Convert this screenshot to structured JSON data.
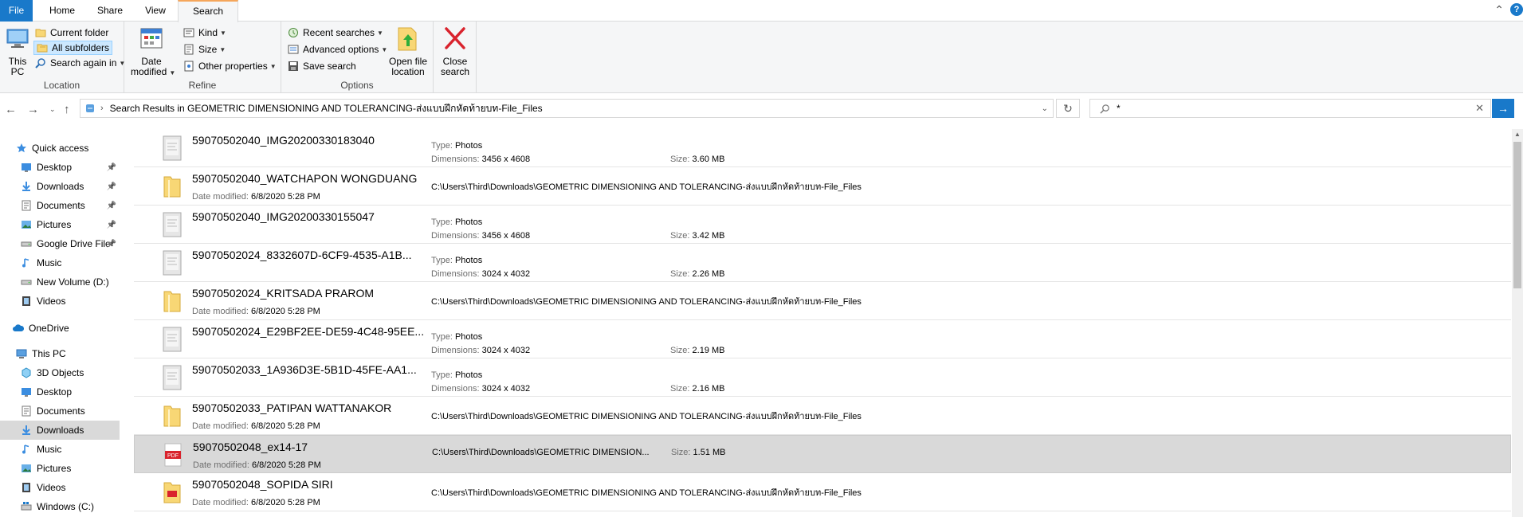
{
  "tabs": {
    "file": "File",
    "home": "Home",
    "share": "Share",
    "view": "View",
    "search": "Search"
  },
  "ribbon": {
    "location": {
      "this_pc": "This PC",
      "current_folder": "Current folder",
      "all_subfolders": "All subfolders",
      "search_again_in": "Search again in",
      "label": "Location"
    },
    "refine": {
      "date_modified_1": "Date",
      "date_modified_2": "modified",
      "kind": "Kind",
      "size": "Size",
      "other_properties": "Other properties",
      "label": "Refine"
    },
    "options": {
      "recent_searches": "Recent searches",
      "advanced_options": "Advanced options",
      "save_search": "Save search",
      "open_file_location_1": "Open file",
      "open_file_location_2": "location",
      "label": "Options"
    },
    "close": {
      "line1": "Close",
      "line2": "search"
    }
  },
  "address": {
    "path": "Search Results in GEOMETRIC DIMENSIONING AND TOLERANCING-ส่งแบบฝึกหัดท้ายบท-File_Files",
    "search_value": "*"
  },
  "sidebar": {
    "items": [
      {
        "label": "Quick access",
        "icon": "star-icon",
        "pinned": false
      },
      {
        "label": "Desktop",
        "icon": "desktop-icon",
        "pinned": true
      },
      {
        "label": "Downloads",
        "icon": "download-icon",
        "pinned": true
      },
      {
        "label": "Documents",
        "icon": "documents-icon",
        "pinned": true
      },
      {
        "label": "Pictures",
        "icon": "pictures-icon",
        "pinned": true
      },
      {
        "label": "Google Drive File",
        "icon": "drive-icon",
        "pinned": true
      },
      {
        "label": "Music",
        "icon": "music-icon",
        "pinned": false
      },
      {
        "label": "New Volume (D:)",
        "icon": "drive-icon",
        "pinned": false
      },
      {
        "label": "Videos",
        "icon": "videos-icon",
        "pinned": false
      },
      {
        "label": "OneDrive",
        "icon": "cloud-icon",
        "pinned": false
      },
      {
        "label": "This PC",
        "icon": "computer-icon",
        "pinned": false
      },
      {
        "label": "3D Objects",
        "icon": "cube-icon",
        "pinned": false
      },
      {
        "label": "Desktop",
        "icon": "desktop-icon",
        "pinned": false
      },
      {
        "label": "Documents",
        "icon": "documents-icon",
        "pinned": false
      },
      {
        "label": "Downloads",
        "icon": "download-icon",
        "pinned": false,
        "selected": true
      },
      {
        "label": "Music",
        "icon": "music-icon",
        "pinned": false
      },
      {
        "label": "Pictures",
        "icon": "pictures-icon",
        "pinned": false
      },
      {
        "label": "Videos",
        "icon": "videos-icon",
        "pinned": false
      },
      {
        "label": "Windows (C:)",
        "icon": "windows-drive-icon",
        "pinned": false
      }
    ]
  },
  "labels": {
    "type": "Type:",
    "dimensions": "Dimensions:",
    "size": "Size:",
    "date_modified": "Date modified:"
  },
  "results": [
    {
      "name": "59070502040_IMG20200330183040",
      "kind": "photo",
      "type": "Photos",
      "dimensions": "3456 x 4608",
      "size": "3.60 MB"
    },
    {
      "name": "59070502040_WATCHAPON WONGDUANG",
      "kind": "folder",
      "date": "6/8/2020 5:28 PM",
      "path": "C:\\Users\\Third\\Downloads\\GEOMETRIC DIMENSIONING AND TOLERANCING-ส่งแบบฝึกหัดท้ายบท-File_Files"
    },
    {
      "name": "59070502040_IMG20200330155047",
      "kind": "photo",
      "type": "Photos",
      "dimensions": "3456 x 4608",
      "size": "3.42 MB"
    },
    {
      "name": "59070502024_8332607D-6CF9-4535-A1B...",
      "kind": "photo",
      "type": "Photos",
      "dimensions": "3024 x 4032",
      "size": "2.26 MB"
    },
    {
      "name": "59070502024_KRITSADA PRAROM",
      "kind": "folder",
      "date": "6/8/2020 5:28 PM",
      "path": "C:\\Users\\Third\\Downloads\\GEOMETRIC DIMENSIONING AND TOLERANCING-ส่งแบบฝึกหัดท้ายบท-File_Files"
    },
    {
      "name": "59070502024_E29BF2EE-DE59-4C48-95EE...",
      "kind": "photo",
      "type": "Photos",
      "dimensions": "3024 x 4032",
      "size": "2.19 MB"
    },
    {
      "name": "59070502033_1A936D3E-5B1D-45FE-AA1...",
      "kind": "photo",
      "type": "Photos",
      "dimensions": "3024 x 4032",
      "size": "2.16 MB"
    },
    {
      "name": "59070502033_PATIPAN WATTANAKOR",
      "kind": "folder",
      "date": "6/8/2020 5:28 PM",
      "path": "C:\\Users\\Third\\Downloads\\GEOMETRIC DIMENSIONING AND TOLERANCING-ส่งแบบฝึกหัดท้ายบท-File_Files"
    },
    {
      "name": "59070502048_ex14-17",
      "kind": "pdf",
      "date": "6/8/2020 5:28 PM",
      "path": "C:\\Users\\Third\\Downloads\\GEOMETRIC DIMENSION...",
      "size": "1.51 MB",
      "selected": true
    },
    {
      "name": "59070502048_SOPIDA SIRI",
      "kind": "pdf-folder",
      "date": "6/8/2020 5:28 PM",
      "path": "C:\\Users\\Third\\Downloads\\GEOMETRIC DIMENSIONING AND TOLERANCING-ส่งแบบฝึกหัดท้ายบท-File_Files"
    }
  ],
  "pdf_badge": "PDF",
  "colors": {
    "accent": "#1979ca",
    "selection": "#d9d9d9",
    "folder": "#f8d775",
    "tab_highlight": "#f5a65b"
  }
}
